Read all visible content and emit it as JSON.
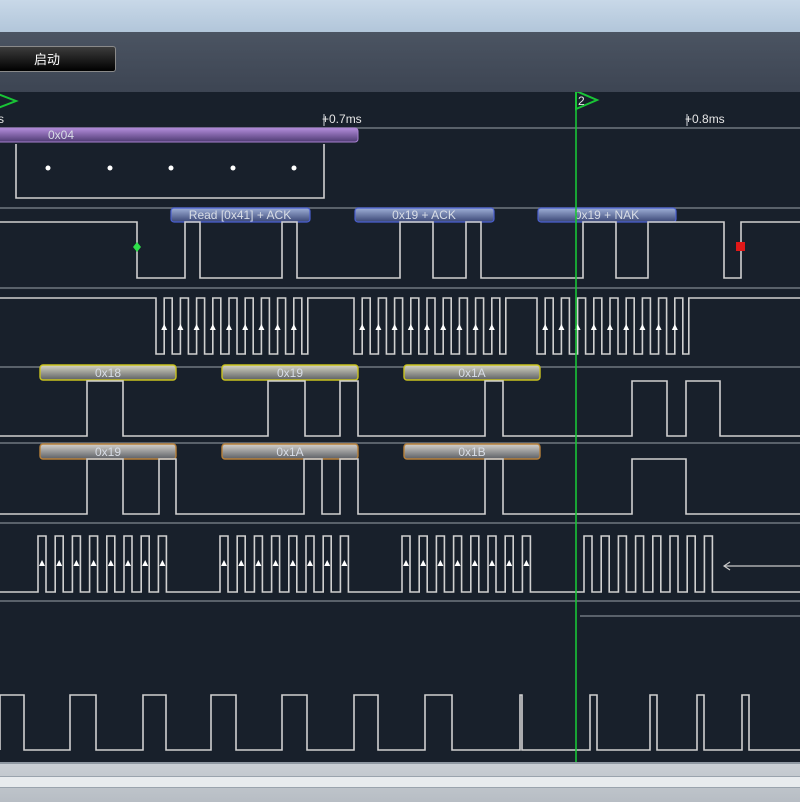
{
  "toolbar": {
    "start_label": "启动"
  },
  "timeline": {
    "left_edge_label": "s",
    "tick_labels": [
      "+0.7ms",
      "+0.8ms"
    ]
  },
  "markers": [
    {
      "label": "",
      "color": "#19c436"
    },
    {
      "label": "2",
      "color": "#19c436"
    }
  ],
  "decode": {
    "bus_value": "0x04",
    "i2c": [
      "Read [0x41] + ACK",
      "0x19 + ACK",
      "0x19 + NAK"
    ],
    "ch_a": [
      "0x18",
      "0x19",
      "0x1A"
    ],
    "ch_b": [
      "0x19",
      "0x1A",
      "0x1B"
    ]
  },
  "colors": {
    "background": "#18202b",
    "waveform": "#d0d0d0",
    "cursor": "#19c436",
    "purple_bar": "#9a6fc0",
    "blue_bar": "#4a5fd0",
    "yellow_bar": "#c9c21e",
    "brown_bar": "#b7803a",
    "start_marker": "#2ee04a",
    "stop_marker": "#e01818"
  }
}
